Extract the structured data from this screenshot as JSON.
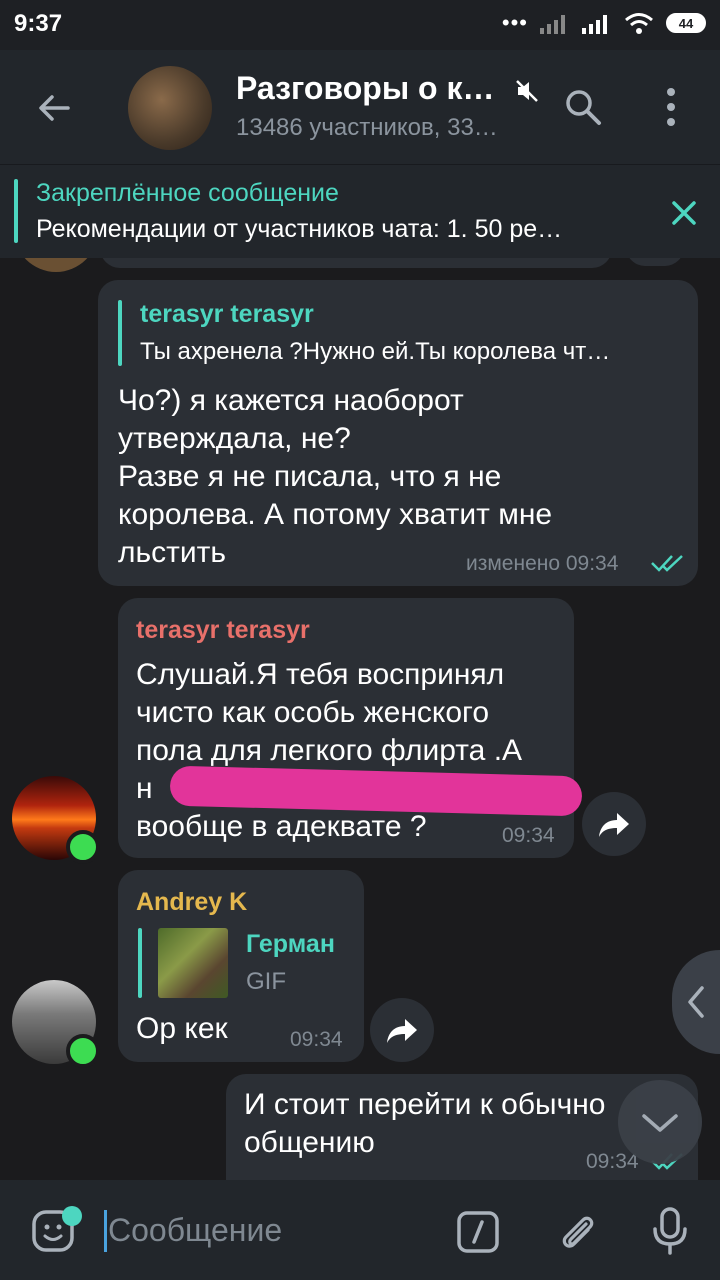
{
  "status_bar": {
    "time": "9:37",
    "battery": "44"
  },
  "header": {
    "title": "Разговоры о к…",
    "subtitle": "13486 участников, 33…"
  },
  "pinned": {
    "title": "Закреплённое сообщение",
    "text": "Рекомендации от участников чата:  1. 50 ре…"
  },
  "messages": [
    {
      "reply_name": "terasyr terasyr",
      "reply_text": "Ты ахренела ?Нужно ей.Ты королева чт…",
      "text": "Чо?) я кажется наоборот\nутверждала, не?\nРазве я не писала, что я не\nкоролева. А потому хватит мне\nльстить",
      "meta": "изменено 09:34"
    },
    {
      "sender": "terasyr terasyr",
      "sender_color": "#e8706a",
      "text": "Слушай.Я тебя воспринял\nчисто как особь женского\nпола для легкого флирта .А\nн\nвообще в адеквате ?",
      "time": "09:34"
    },
    {
      "sender": "Andrey K",
      "sender_color": "#e5b84e",
      "reply_name": "Герман",
      "reply_type": "GIF",
      "text": "Ор кек",
      "time": "09:34"
    },
    {
      "text": "И стоит перейти к обычно\nобщению",
      "time": "09:34"
    }
  ],
  "input": {
    "placeholder": "Сообщение"
  }
}
